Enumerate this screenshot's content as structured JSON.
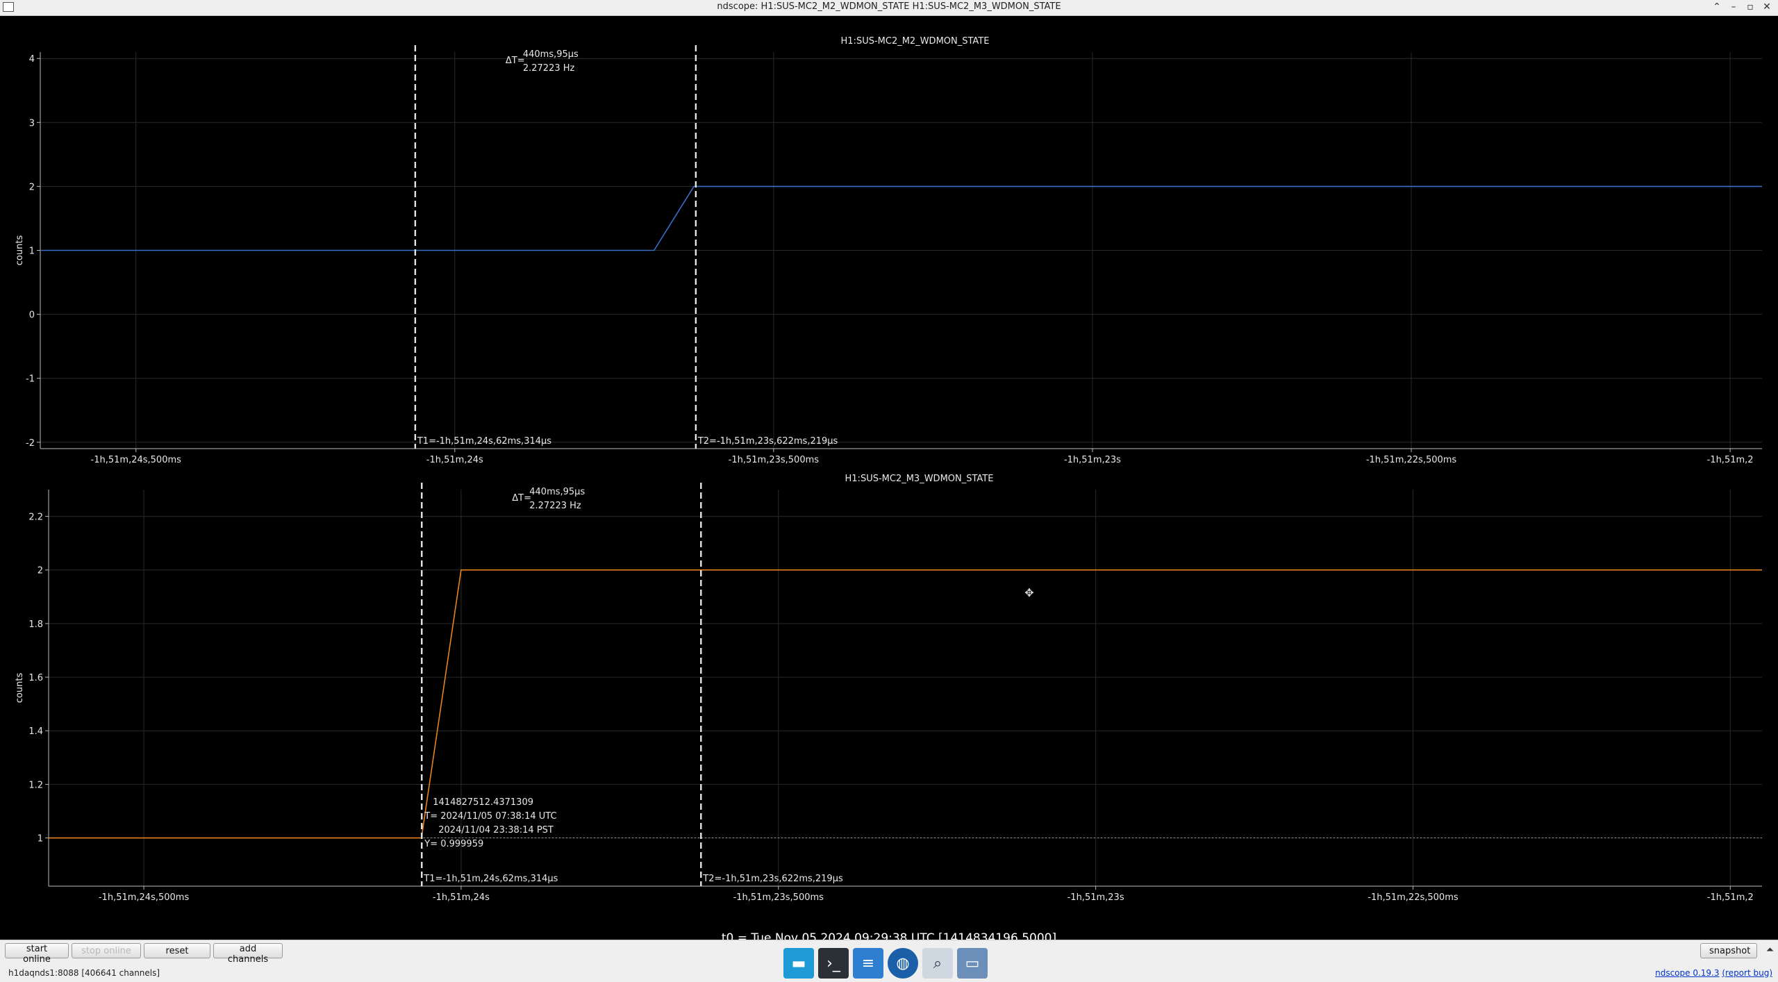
{
  "window": {
    "title": "ndscope: H1:SUS-MC2_M2_WDMON_STATE H1:SUS-MC2_M3_WDMON_STATE",
    "buttons": [
      "⌃",
      "–",
      "▫",
      "✕"
    ]
  },
  "chart_data": [
    {
      "type": "line",
      "title": "H1:SUS-MC2_M2_WDMON_STATE",
      "ylabel": "counts",
      "xlabel": "",
      "xlim": [
        -6684.65,
        -6681.95
      ],
      "ylim": [
        -2.1,
        4.1
      ],
      "yticks": [
        -2,
        -1,
        0,
        1,
        2,
        3,
        4
      ],
      "xticks": [
        {
          "value": -6684.5,
          "label": "-1h,51m,24s,500ms"
        },
        {
          "value": -6684.0,
          "label": "-1h,51m,24s"
        },
        {
          "value": -6683.5,
          "label": "-1h,51m,23s,500ms"
        },
        {
          "value": -6683.0,
          "label": "-1h,51m,23s"
        },
        {
          "value": -6682.5,
          "label": "-1h,51m,22s,500ms"
        },
        {
          "value": -6682.0,
          "label": "-1h,51m,2"
        }
      ],
      "grid": true,
      "series": [
        {
          "color": "#3a6fc8",
          "x": [
            -6684.65,
            -6683.6875,
            -6683.625,
            -6681.95
          ],
          "y": [
            1,
            1,
            2,
            2
          ]
        }
      ],
      "cursors": {
        "t1": -6684.062,
        "t2": -6683.622,
        "t1_label": "T1=-1h,51m,24s,62ms,314µs",
        "t2_label": "T2=-1h,51m,23s,622ms,219µs",
        "delta_label": "ΔT=",
        "delta_value": "440ms,95µs",
        "delta_freq": "2.27223 Hz"
      }
    },
    {
      "type": "line",
      "title": "H1:SUS-MC2_M3_WDMON_STATE",
      "ylabel": "counts",
      "xlabel": "",
      "xlim": [
        -6684.65,
        -6681.95
      ],
      "ylim": [
        0.82,
        2.3
      ],
      "yticks": [
        1,
        1.2,
        1.4,
        1.6,
        1.8,
        2,
        2.2
      ],
      "xticks": [
        {
          "value": -6684.5,
          "label": "-1h,51m,24s,500ms"
        },
        {
          "value": -6684.0,
          "label": "-1h,51m,24s"
        },
        {
          "value": -6683.5,
          "label": "-1h,51m,23s,500ms"
        },
        {
          "value": -6683.0,
          "label": "-1h,51m,23s"
        },
        {
          "value": -6682.5,
          "label": "-1h,51m,22s,500ms"
        },
        {
          "value": -6682.0,
          "label": "-1h,51m,2"
        }
      ],
      "grid": true,
      "series": [
        {
          "color": "#e8821e",
          "x": [
            -6684.65,
            -6684.0625,
            -6684.0,
            -6681.95
          ],
          "y": [
            1,
            1,
            2,
            2
          ]
        }
      ],
      "reference_line": {
        "y": 1,
        "style": "dotted"
      },
      "cursors": {
        "t1": -6684.062,
        "t2": -6683.622,
        "t1_label": "T1=-1h,51m,24s,62ms,314µs",
        "t2_label": "T2=-1h,51m,23s,622ms,219µs",
        "delta_label": "ΔT=",
        "delta_value": "440ms,95µs",
        "delta_freq": "2.27223 Hz"
      },
      "point_annotation": {
        "gps": "1414827512.4371309",
        "utc": "T= 2024/11/05 07:38:14 UTC",
        "pst": "2024/11/04 23:38:14 PST",
        "y": "Y= 0.999959"
      }
    }
  ],
  "t0_label": "t0 = Tue Nov 05 2024 09:29:38 UTC [1414834196.5000]",
  "toolbar": {
    "start_online": "start online",
    "stop_online": "stop online",
    "reset": "reset",
    "add_channels": "add channels",
    "snapshot": "snapshot"
  },
  "status": {
    "server": "h1daqnds1:8088  [406641 channels]",
    "version_link": "ndscope 0.19.3",
    "report_link": "(report bug)"
  },
  "taskbar": [
    "desktop-icon",
    "terminal-icon",
    "text-editor-icon",
    "browser-icon",
    "search-icon",
    "folder-icon"
  ]
}
